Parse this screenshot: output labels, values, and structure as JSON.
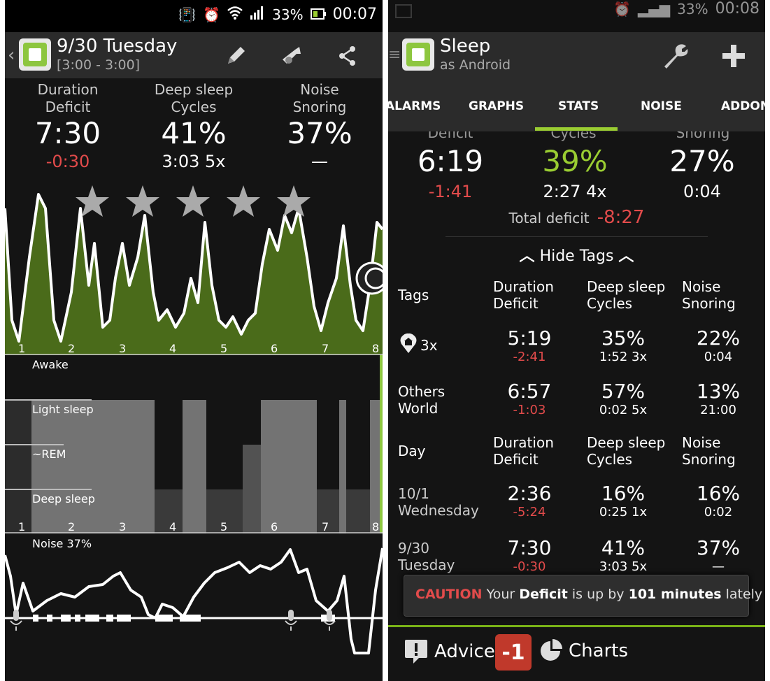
{
  "status": {
    "battery_pct": "33%",
    "time": "00:07",
    "time_right": "00:08"
  },
  "left": {
    "title": "9/30 Tuesday",
    "subtitle": "[3:00 - 3:00]",
    "stats": [
      {
        "label1": "Duration",
        "label2": "Deficit",
        "value": "7:30",
        "sub": "-0:30",
        "sub_color": "#e24b4b"
      },
      {
        "label1": "Deep sleep",
        "label2": "Cycles",
        "value": "41%",
        "sub": "3:03 5x",
        "sub_color": "#ffffff"
      },
      {
        "label1": "Noise",
        "label2": "Snoring",
        "value": "37%",
        "sub": "—",
        "sub_color": "#ffffff"
      }
    ],
    "stars": 5,
    "hour_labels": [
      "1",
      "2",
      "3",
      "4",
      "5",
      "6",
      "7",
      "8"
    ],
    "phase_labels": {
      "awake": "Awake",
      "light": "Light sleep",
      "rem": "~REM",
      "deep": "Deep sleep"
    },
    "noise_label": "Noise 37%"
  },
  "right": {
    "title": "Sleep",
    "subtitle": "as Android",
    "tabs": [
      "ALARMS",
      "GRAPHS",
      "STATS",
      "NOISE",
      "ADDON"
    ],
    "active_tab": "STATS",
    "partial_labels": [
      "Deficit",
      "Cycles",
      "Snoring"
    ],
    "summary": [
      {
        "value": "6:19",
        "sub": "-1:41",
        "sub_color": "#e24b4b",
        "value_color": "#ffffff"
      },
      {
        "value": "39%",
        "sub": "2:27 4x",
        "sub_color": "#ffffff",
        "value_color": "#9acd32"
      },
      {
        "value": "27%",
        "sub": "0:04",
        "sub_color": "#ffffff",
        "value_color": "#ffffff"
      }
    ],
    "total_deficit_label": "Total deficit",
    "total_deficit_value": "-8:27",
    "hide_tags": "Hide Tags",
    "tags_header": {
      "label": "Tags",
      "c1a": "Duration",
      "c1b": "Deficit",
      "c2a": "Deep sleep",
      "c2b": "Cycles",
      "c3a": "Noise",
      "c3b": "Snoring"
    },
    "tag_rows": [
      {
        "label1": "3x",
        "label2": "",
        "dur": "5:19",
        "def": "-2:41",
        "deep": "35%",
        "deep_color": "#9acd32",
        "cyc": "1:52 3x",
        "noise": "22%",
        "snore": "0:04"
      },
      {
        "label1": "Others",
        "label2": "World",
        "dur": "6:57",
        "def": "-1:03",
        "deep": "57%",
        "deep_color": "#9acd32",
        "cyc": "0:02 5x",
        "noise": "13%",
        "snore": "21:00"
      }
    ],
    "day_header": {
      "label": "Day",
      "c1a": "Duration",
      "c1b": "Deficit",
      "c2a": "Deep sleep",
      "c2b": "Cycles",
      "c3a": "Noise",
      "c3b": "Snoring"
    },
    "day_rows": [
      {
        "label1": "10/1",
        "label2": "Wednesday",
        "dur": "2:36",
        "def": "-5:24",
        "deep": "16%",
        "deep_color": "#e24b4b",
        "cyc": "0:25 1x",
        "noise": "16%",
        "snore": "0:02"
      },
      {
        "label1": "9/30",
        "label2": "Tuesday",
        "dur": "7:30",
        "def": "-0:30",
        "deep": "41%",
        "deep_color": "#9acd32",
        "cyc": "3:03 5x",
        "noise": "37%",
        "snore": "—"
      }
    ],
    "caution": {
      "word": "CAUTION",
      "t1": "Your",
      "t2": "Deficit",
      "t3": "is up by",
      "t4": "101 minutes",
      "t5": "lately"
    },
    "bottom": {
      "advice": "Advice",
      "badge": "-1",
      "charts": "Charts"
    }
  }
}
